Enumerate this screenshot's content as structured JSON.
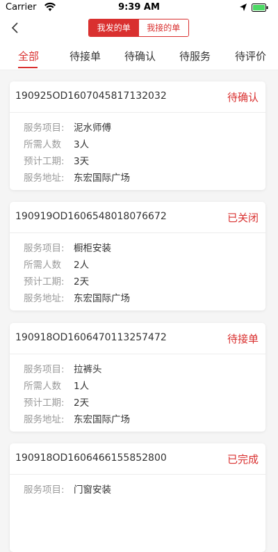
{
  "status_bar": {
    "carrier": "Carrier",
    "time": "9:39 AM"
  },
  "nav": {
    "segments": [
      {
        "label": "我发的单",
        "active": true
      },
      {
        "label": "我接的单",
        "active": false
      }
    ]
  },
  "tabs": [
    "全部",
    "待接单",
    "待确认",
    "待服务",
    "待评价"
  ],
  "labels": {
    "project": "服务项目:",
    "people": "所需人数",
    "duration": "预计工期:",
    "address": "服务地址:"
  },
  "orders": [
    {
      "id": "190925OD1607045817132032",
      "status": "待确认",
      "project": "泥水师傅",
      "people": "3人",
      "duration": "3天",
      "address": "东宏国际广场"
    },
    {
      "id": "190919OD1606548018076672",
      "status": "已关闭",
      "project": "橱柜安装",
      "people": "2人",
      "duration": "2天",
      "address": "东宏国际广场"
    },
    {
      "id": "190918OD1606470113257472",
      "status": "待接单",
      "project": "拉裤头",
      "people": "1人",
      "duration": "2天",
      "address": "东宏国际广场"
    },
    {
      "id": "190918OD1606466155852800",
      "status": "已完成",
      "project": "门窗安装",
      "people": "",
      "duration": "",
      "address": ""
    }
  ],
  "colors": {
    "accent": "#d9302f"
  }
}
